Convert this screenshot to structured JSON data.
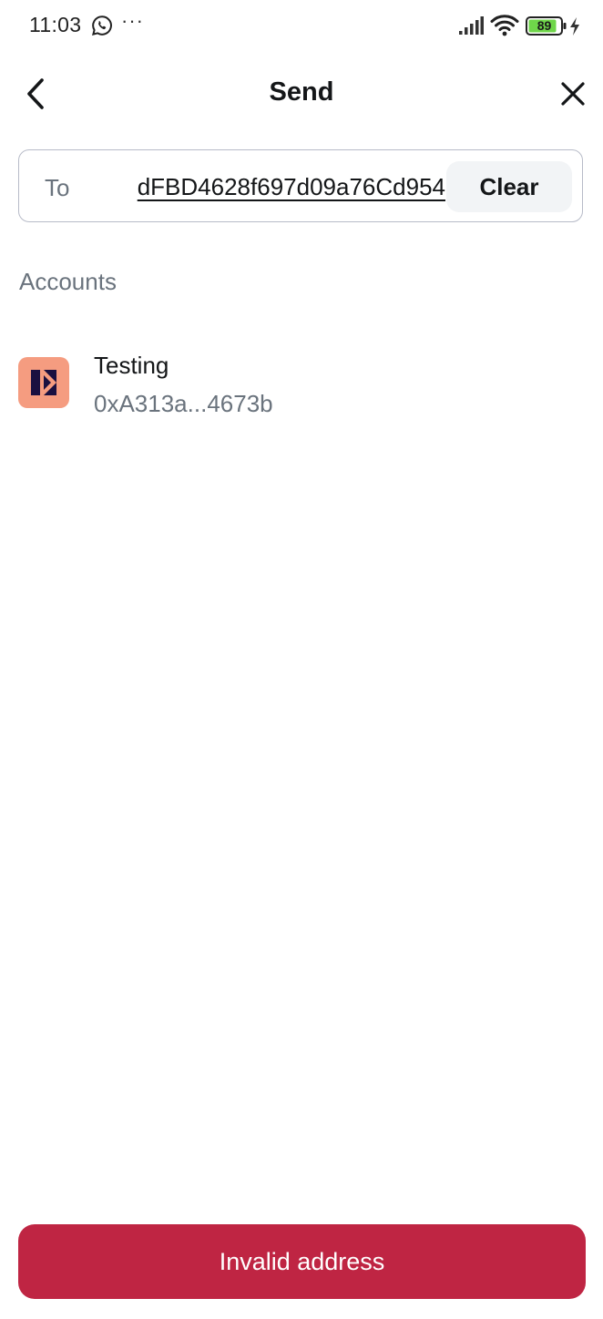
{
  "status_bar": {
    "time": "11:03",
    "more": "···",
    "battery_level": "89",
    "battery_color": "#6fd64a"
  },
  "header": {
    "title": "Send",
    "back_icon": "chevron-left-icon",
    "close_icon": "close-icon"
  },
  "to_field": {
    "label": "To",
    "value": "dFBD4628f697d09a76Cd954",
    "clear_label": "Clear"
  },
  "accounts": {
    "section_title": "Accounts",
    "items": [
      {
        "name": "Testing",
        "address": "0xA313a...4673b",
        "avatar_color": "#f59c80"
      }
    ]
  },
  "footer": {
    "button_label": "Invalid address",
    "button_color": "#bf2543"
  }
}
